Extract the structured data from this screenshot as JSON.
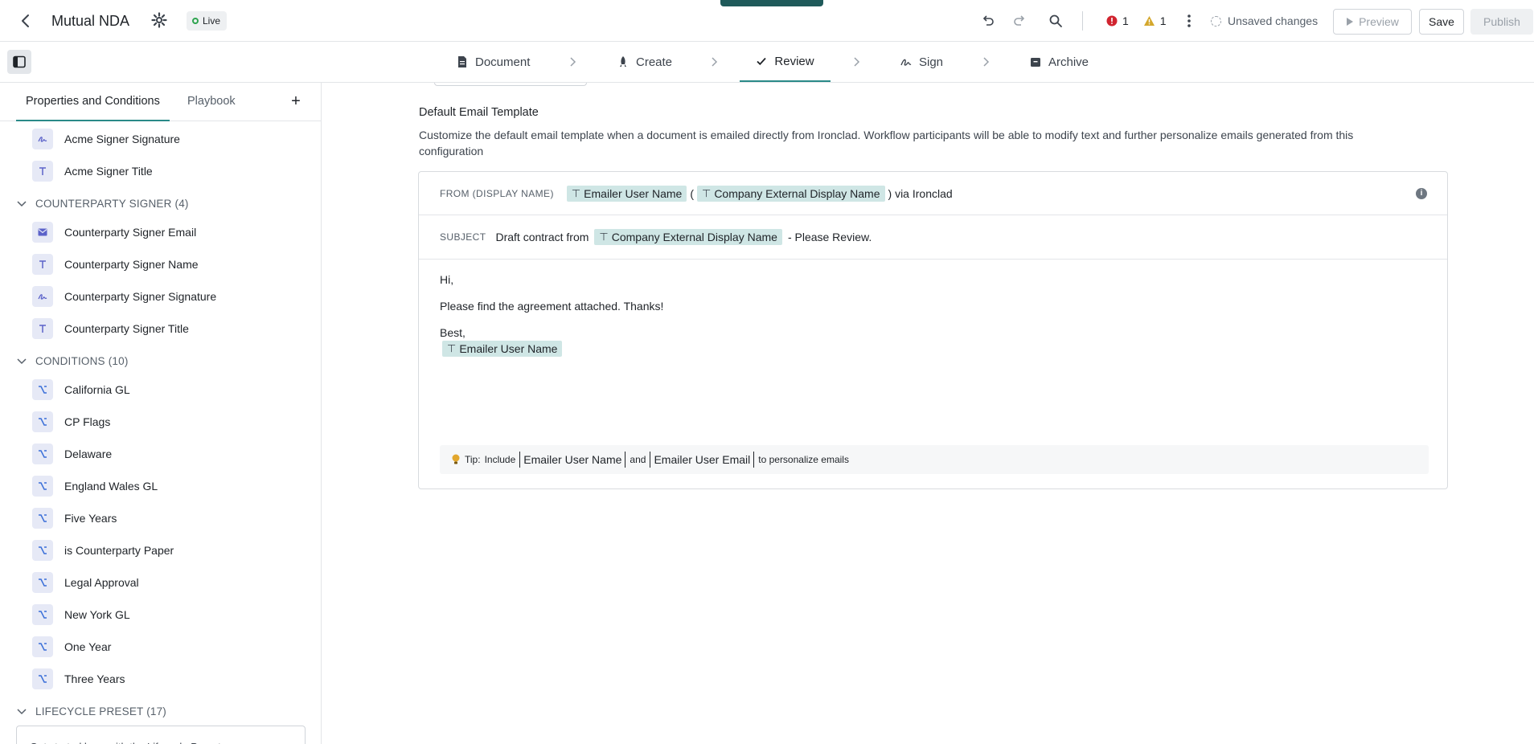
{
  "header": {
    "title": "Mutual NDA",
    "status": "Live",
    "error_count": "1",
    "warning_count": "1",
    "unsaved_label": "Unsaved changes",
    "preview_label": "Preview",
    "save_label": "Save",
    "publish_label": "Publish"
  },
  "steps": [
    {
      "label": "Document",
      "icon": "document-icon"
    },
    {
      "label": "Create",
      "icon": "rocket-icon"
    },
    {
      "label": "Review",
      "icon": "check-icon"
    },
    {
      "label": "Sign",
      "icon": "signature-icon"
    },
    {
      "label": "Archive",
      "icon": "archive-icon"
    }
  ],
  "active_step": "Review",
  "sidebar": {
    "tabs": [
      "Properties and Conditions",
      "Playbook"
    ],
    "top_items": [
      {
        "label": "Acme Signer Signature",
        "icon": "signature-icon"
      },
      {
        "label": "Acme Signer Title",
        "icon": "text-icon"
      }
    ],
    "groups": [
      {
        "label": "COUNTERPARTY SIGNER (4)",
        "items": [
          {
            "label": "Counterparty Signer Email",
            "icon": "email-icon"
          },
          {
            "label": "Counterparty Signer Name",
            "icon": "text-icon"
          },
          {
            "label": "Counterparty Signer Signature",
            "icon": "signature-icon"
          },
          {
            "label": "Counterparty Signer Title",
            "icon": "text-icon"
          }
        ]
      },
      {
        "label": "CONDITIONS (10)",
        "items": [
          {
            "label": "California GL",
            "icon": "condition-icon"
          },
          {
            "label": "CP Flags",
            "icon": "condition-icon"
          },
          {
            "label": "Delaware",
            "icon": "condition-icon"
          },
          {
            "label": "England Wales GL",
            "icon": "condition-icon"
          },
          {
            "label": "Five Years",
            "icon": "condition-icon"
          },
          {
            "label": "is Counterparty Paper",
            "icon": "condition-icon"
          },
          {
            "label": "Legal Approval",
            "icon": "condition-icon"
          },
          {
            "label": "New York GL",
            "icon": "condition-icon"
          },
          {
            "label": "One Year",
            "icon": "condition-icon"
          },
          {
            "label": "Three Years",
            "icon": "condition-icon"
          }
        ]
      },
      {
        "label": "LIFECYCLE PRESET (17)",
        "items": []
      }
    ],
    "partial_box_text": "Get started here with the Lifecycle Preset"
  },
  "email": {
    "section_title": "Default Email Template",
    "description": "Customize the default email template when a document is emailed directly from Ironclad. Workflow participants will be able to modify text and further personalize emails generated from this configuration",
    "from_label": "FROM (DISPLAY NAME)",
    "from_pill_1": "Emailer User Name",
    "from_open": "(",
    "from_pill_2": "Company External Display Name",
    "from_suffix": ") via Ironclad",
    "subject_label": "SUBJECT",
    "subject_prefix": "Draft contract from",
    "subject_pill": "Company External Display Name",
    "subject_suffix": "- Please Review.",
    "body_greeting": "Hi,",
    "body_line": "Please find the agreement attached. Thanks!",
    "body_signoff": "Best,",
    "body_pill": "Emailer User Name",
    "tip_prefix": "Tip:",
    "tip_include": "Include",
    "tip_token_1": "Emailer User Name",
    "tip_and": "and",
    "tip_token_2": "Emailer User Email",
    "tip_suffix": "to personalize emails"
  },
  "colors": {
    "accent": "#2a8a88",
    "pill": "#cfe6e5",
    "error": "#d1242f",
    "warning": "#d4a72c"
  }
}
